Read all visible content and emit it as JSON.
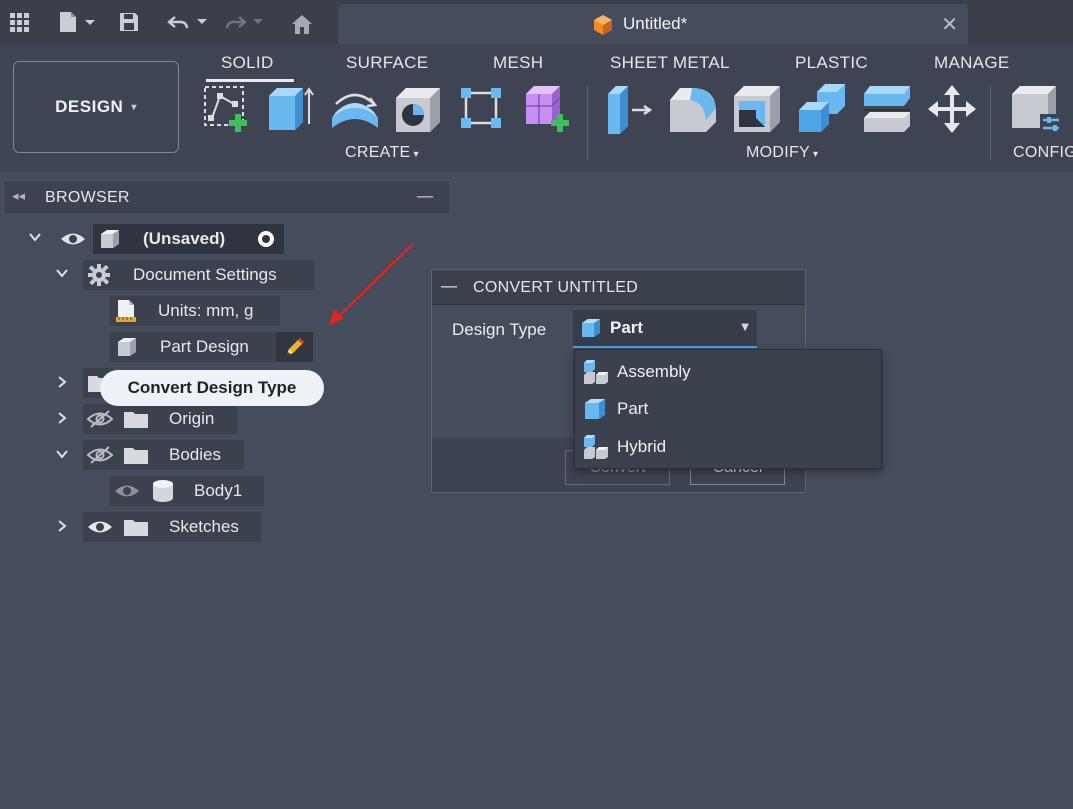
{
  "document_tab": {
    "title": "Untitled*",
    "close": "✕"
  },
  "workspace": {
    "label": "DESIGN",
    "caret": "▾"
  },
  "ribbon": {
    "tabs": [
      "SOLID",
      "SURFACE",
      "MESH",
      "SHEET METAL",
      "PLASTIC",
      "MANAGE"
    ],
    "active_tab": "SOLID",
    "groups": [
      {
        "label": "CREATE",
        "caret": "▾"
      },
      {
        "label": "MODIFY",
        "caret": "▾"
      },
      {
        "label": "CONFIG"
      }
    ]
  },
  "browser": {
    "title": "BROWSER",
    "collapse_glyph": "◂◂",
    "minimize_glyph": "—",
    "root": {
      "label": "(Unsaved)"
    },
    "nodes": {
      "document_settings": "Document Settings",
      "units": "Units: mm, g",
      "part_design": "Part Design",
      "origin": "Origin",
      "bodies": "Bodies",
      "body1": "Body1",
      "sketches": "Sketches"
    }
  },
  "tooltip": {
    "text": "Convert Design Type"
  },
  "dialog": {
    "title": "CONVERT UNTITLED",
    "minus_glyph": "—",
    "design_type_label": "Design Type",
    "selected_value": "Part",
    "convert_label": "Convert",
    "cancel_label": "Cancel",
    "options": [
      "Assembly",
      "Part",
      "Hybrid"
    ]
  },
  "colors": {
    "background": "#454c5b",
    "titlebar": "#3a3f49",
    "ribbon": "#3e4451",
    "accent_blue": "#4ea0e6",
    "cube_blue": "#6ab8f0",
    "annotation_red": "#e02424",
    "tooltip_bg": "#eef1f6"
  }
}
